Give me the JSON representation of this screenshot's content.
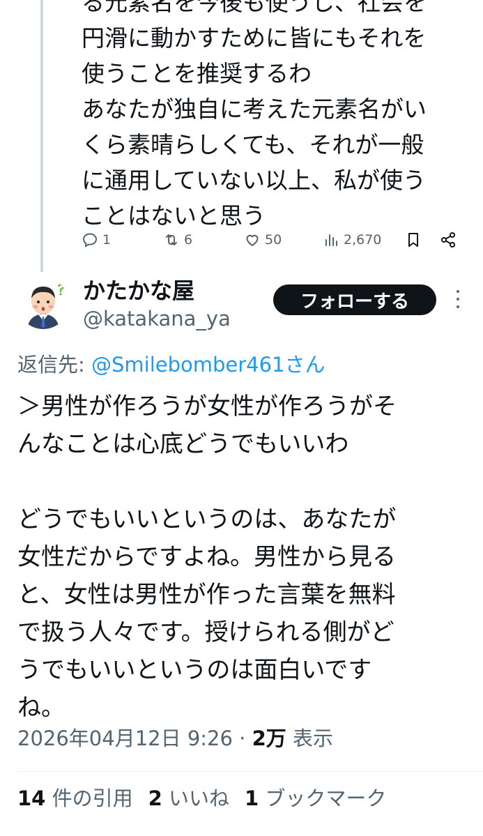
{
  "previous_tweet": {
    "lines": [
      "る元素名を今後も使うし、社会を",
      "円滑に動かすために皆にもそれを",
      "使うことを推奨するわ",
      "あなたが独自に考えた元素名がい",
      "くら素晴らしくても、それが一般",
      "に通用していない以上、私が使う",
      "ことはないと思う"
    ],
    "actions": {
      "replies": "1",
      "retweets": "6",
      "likes": "50",
      "views": "2,670"
    }
  },
  "tweet": {
    "author_name": "かたかな屋",
    "author_handle": "@katakana_ya",
    "follow_label": "フォローする",
    "replying_prefix": "返信先: ",
    "replying_mention": "@Smilebomber461さん",
    "body_lines": [
      "＞男性が作ろうが女性が作ろうがそ",
      "んなことは心底どうでもいいわ",
      "",
      "どうでもいいというのは、あなたが",
      "女性だからですよね。男性から見る",
      "と、女性は男性が作った言葉を無料",
      "で扱う人々です。授けられる側がど",
      "うでもいいというのは面白いです",
      "ね。"
    ],
    "timestamp": "2026年04月12日 9:26",
    "separator": " · ",
    "views_count": "2万",
    "views_label": " 表示",
    "quotes_count": "14",
    "quotes_label": " 件の引用",
    "likes_count": "2",
    "likes_label": " いいね",
    "bookmarks_count": "1",
    "bookmarks_label": " ブックマーク"
  },
  "colors": {
    "text": "#0f1419",
    "secondary": "#536471",
    "link": "#1d9bf0",
    "thread_line": "#cfd9de",
    "button_bg": "#0f1419"
  }
}
